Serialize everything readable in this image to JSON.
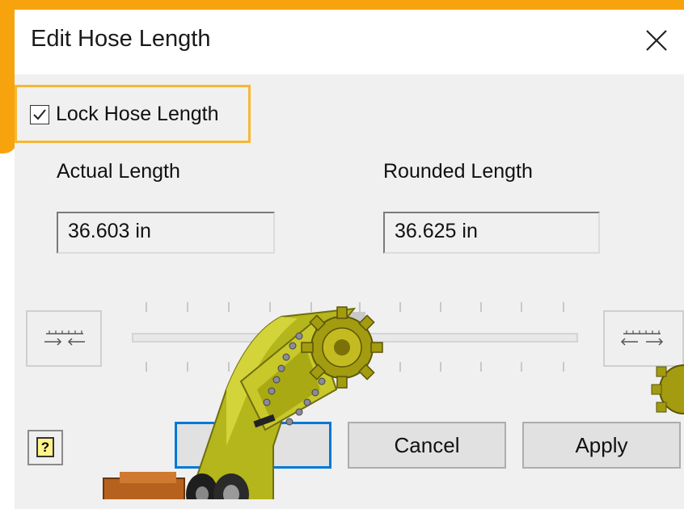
{
  "window": {
    "title": "Edit Hose Length"
  },
  "lock": {
    "label": "Lock Hose Length",
    "checked": true
  },
  "actual": {
    "label": "Actual Length",
    "value": "36.603 in"
  },
  "rounded": {
    "label": "Rounded Length",
    "value": "36.625 in"
  },
  "slider": {
    "left_icon": "shorten-arrows-icon",
    "right_icon": "lengthen-arrows-icon"
  },
  "buttons": {
    "ok": "",
    "cancel": "Cancel",
    "apply": "Apply",
    "help_glyph": "?"
  },
  "colors": {
    "accent_orange": "#f7a30e",
    "highlight": "#f7b733",
    "default_button_border": "#0078d7",
    "model_yellow": "#b8b81e"
  }
}
